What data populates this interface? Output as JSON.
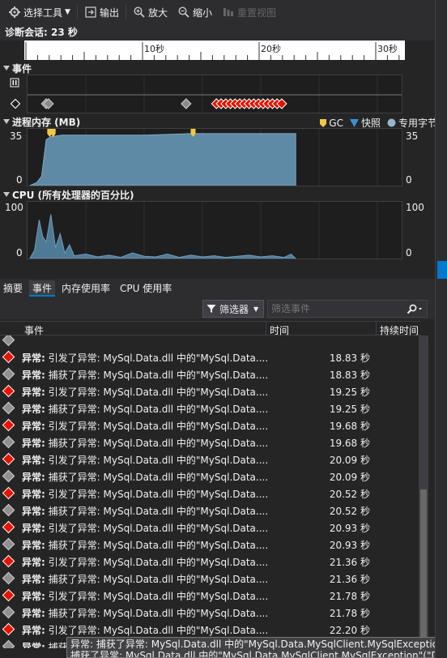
{
  "toolbar": {
    "select_tools": "选择工具",
    "output": "输出",
    "zoom_in": "放大",
    "zoom_out": "缩小",
    "reset_view": "重置视图"
  },
  "session": {
    "label": "诊断会话: 23 秒"
  },
  "ruler": {
    "ticks": [
      "10秒",
      "20秒",
      "30秒"
    ]
  },
  "events": {
    "title": "事件"
  },
  "memory": {
    "title": "进程内存 (MB)",
    "ymax": "35",
    "ymin": "0",
    "legend": {
      "gc": "GC",
      "snapshot": "快照",
      "private_bytes": "专用字节"
    },
    "colors": {
      "area": "#5f8aa6",
      "gc": "#f2c744",
      "snapshot": "#3a8fd6"
    },
    "chart_data": {
      "type": "area",
      "x_seconds": [
        0.2,
        0.8,
        1.2,
        1.6,
        2.0,
        3.0,
        5.0,
        8.0,
        10.0,
        12.0,
        14.0,
        16.0,
        18.0,
        20.0,
        22.0,
        23.0
      ],
      "values_mb": [
        0,
        2,
        6,
        30,
        32,
        33,
        33,
        33,
        33,
        33.5,
        34,
        34,
        34,
        34,
        34,
        34
      ],
      "ylim": [
        0,
        35
      ]
    }
  },
  "cpu": {
    "title": "CPU (所有处理器的百分比)",
    "ymax": "100",
    "ymin": "0",
    "chart_data": {
      "type": "area",
      "x_seconds": [
        0.2,
        0.6,
        1.0,
        1.3,
        1.6,
        2.0,
        2.4,
        2.8,
        3.2,
        3.6,
        4.0,
        5.0,
        6.0,
        7.0,
        8.0,
        9.0,
        10.0,
        11.0,
        12.0,
        13.0,
        14.0,
        15.0,
        16.0,
        17.0,
        18.0,
        19.0,
        20.0,
        21.0,
        22.0,
        22.6,
        23.0
      ],
      "values_pct": [
        0,
        15,
        70,
        40,
        30,
        80,
        20,
        45,
        10,
        25,
        5,
        8,
        3,
        6,
        2,
        10,
        4,
        3,
        8,
        2,
        6,
        3,
        5,
        2,
        4,
        6,
        3,
        5,
        2,
        8,
        0
      ],
      "ylim": [
        0,
        100
      ]
    }
  },
  "tabs": [
    "摘要",
    "事件",
    "内存使用率",
    "CPU 使用率"
  ],
  "filter": {
    "button": "筛选器",
    "placeholder": "筛选事件"
  },
  "table": {
    "columns": [
      "事件",
      "时间",
      "持续时间"
    ],
    "rows": [
      {
        "kind": "thrown",
        "prefix": "异常:",
        "text": "引发了异常: MySql.Data.dll 中的\"MySql.Data....",
        "time": "18.83 秒"
      },
      {
        "kind": "caught",
        "prefix": "异常:",
        "text": "捕获了异常: MySql.Data.dll 中的\"MySql.Data....",
        "time": "18.83 秒"
      },
      {
        "kind": "thrown",
        "prefix": "异常:",
        "text": "引发了异常: MySql.Data.dll 中的\"MySql.Data....",
        "time": "19.25 秒"
      },
      {
        "kind": "caught",
        "prefix": "异常:",
        "text": "捕获了异常: MySql.Data.dll 中的\"MySql.Data....",
        "time": "19.25 秒"
      },
      {
        "kind": "thrown",
        "prefix": "异常:",
        "text": "引发了异常: MySql.Data.dll 中的\"MySql.Data....",
        "time": "19.68 秒"
      },
      {
        "kind": "caught",
        "prefix": "异常:",
        "text": "捕获了异常: MySql.Data.dll 中的\"MySql.Data....",
        "time": "19.68 秒"
      },
      {
        "kind": "thrown",
        "prefix": "异常:",
        "text": "引发了异常: MySql.Data.dll 中的\"MySql.Data....",
        "time": "20.09 秒"
      },
      {
        "kind": "caught",
        "prefix": "异常:",
        "text": "捕获了异常: MySql.Data.dll 中的\"MySql.Data....",
        "time": "20.09 秒"
      },
      {
        "kind": "thrown",
        "prefix": "异常:",
        "text": "引发了异常: MySql.Data.dll 中的\"MySql.Data....",
        "time": "20.52 秒"
      },
      {
        "kind": "caught",
        "prefix": "异常:",
        "text": "捕获了异常: MySql.Data.dll 中的\"MySql.Data....",
        "time": "20.52 秒"
      },
      {
        "kind": "thrown",
        "prefix": "异常:",
        "text": "引发了异常: MySql.Data.dll 中的\"MySql.Data....",
        "time": "20.93 秒"
      },
      {
        "kind": "caught",
        "prefix": "异常:",
        "text": "捕获了异常: MySql.Data.dll 中的\"MySql.Data....",
        "time": "20.93 秒"
      },
      {
        "kind": "thrown",
        "prefix": "异常:",
        "text": "引发了异常: MySql.Data.dll 中的\"MySql.Data....",
        "time": "21.36 秒"
      },
      {
        "kind": "caught",
        "prefix": "异常:",
        "text": "捕获了异常: MySql.Data.dll 中的\"MySql.Data....",
        "time": "21.36 秒"
      },
      {
        "kind": "thrown",
        "prefix": "异常:",
        "text": "引发了异常: MySql.Data.dll 中的\"MySql.Data....",
        "time": "21.78 秒"
      },
      {
        "kind": "caught",
        "prefix": "异常:",
        "text": "捕获了异常: MySql.Data.dll 中的\"MySql.Data....",
        "time": "21.78 秒"
      },
      {
        "kind": "thrown",
        "prefix": "异常:",
        "text": "引发了异常: MySql.Data.dll 中的\"MySql.Data....",
        "time": "22.20 秒"
      },
      {
        "kind": "caught",
        "prefix": "异常:",
        "text": "捕获了异常: MySql.Data.dll 中的\"MySql.Data....",
        "time": ""
      }
    ]
  },
  "tooltip": {
    "line1": "异常: 捕获了异常: MySql.Data.dll 中的\"MySql.Data.MySqlClient.MySqlException\"(\"D",
    "line2": "捕获了异常: MySql.Data.dll 中的\"MySql.Data.MySqlClient.MySqlException\"(\"Duplic"
  },
  "event_markers": {
    "caught_seconds": [
      1.6,
      1.8,
      13.6
    ],
    "thrown_seconds": [
      16.2,
      16.6,
      17.0,
      17.4,
      17.8,
      18.2,
      18.6,
      19.0,
      19.4,
      19.8,
      20.2,
      20.6,
      21.0,
      21.4,
      21.8
    ]
  },
  "gc_markers_seconds": [
    1.9,
    2.2,
    14.2
  ]
}
